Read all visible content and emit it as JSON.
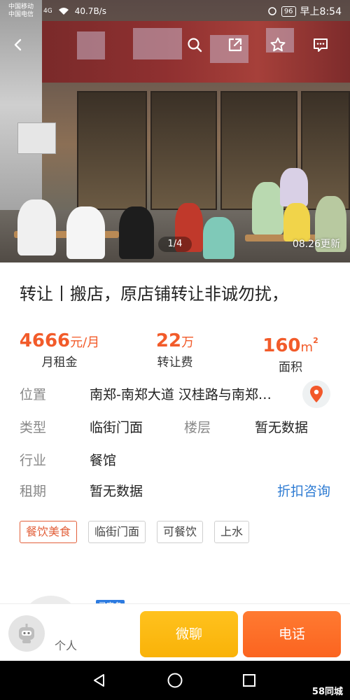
{
  "status_bar": {
    "carrier_1": "中国移动",
    "carrier_2": "中国电信",
    "net_type": "4G",
    "speed": "40.7B/s",
    "battery": "96",
    "time": "早上8:54"
  },
  "hero": {
    "photo_counter": "1/4",
    "update_tag": "08.26更新"
  },
  "listing": {
    "title": "转让丨搬店，原店铺转让非诚勿扰，",
    "stats": [
      {
        "value": "4666",
        "unit": "元/月",
        "label": "月租金"
      },
      {
        "value": "22",
        "unit": "万",
        "label": "转让费"
      },
      {
        "value": "160",
        "unit": "m",
        "sup": "2",
        "label": "面积"
      }
    ],
    "info": {
      "location_label": "位置",
      "location_value": "南郑-南郑大道 汉桂路与南郑…",
      "type_label": "类型",
      "type_value": "临街门面",
      "floor_label": "楼层",
      "floor_value": "暂无数据",
      "industry_label": "行业",
      "industry_value": "餐馆",
      "lease_label": "租期",
      "lease_value": "暂无数据",
      "consult_label": "折扣咨询"
    },
    "tags": [
      "餐饮美食",
      "临街门面",
      "可餐饮",
      "上水"
    ]
  },
  "agent_peek": {
    "verified_badge": "已实名"
  },
  "bottom_bar": {
    "personal_label": "个人",
    "chat_label": "微聊",
    "call_label": "电话"
  },
  "watermark": "58同城",
  "colors": {
    "accent_orange": "#f25b2a",
    "link_blue": "#2f7cd3",
    "chat_yellow": "#f9b208",
    "call_orange": "#fb6420"
  },
  "icons": [
    "back-icon",
    "search-icon",
    "share-icon",
    "star-icon",
    "message-icon",
    "map-pin-icon",
    "robot-avatar-icon",
    "sys-back-icon",
    "sys-home-icon",
    "sys-recent-icon"
  ]
}
